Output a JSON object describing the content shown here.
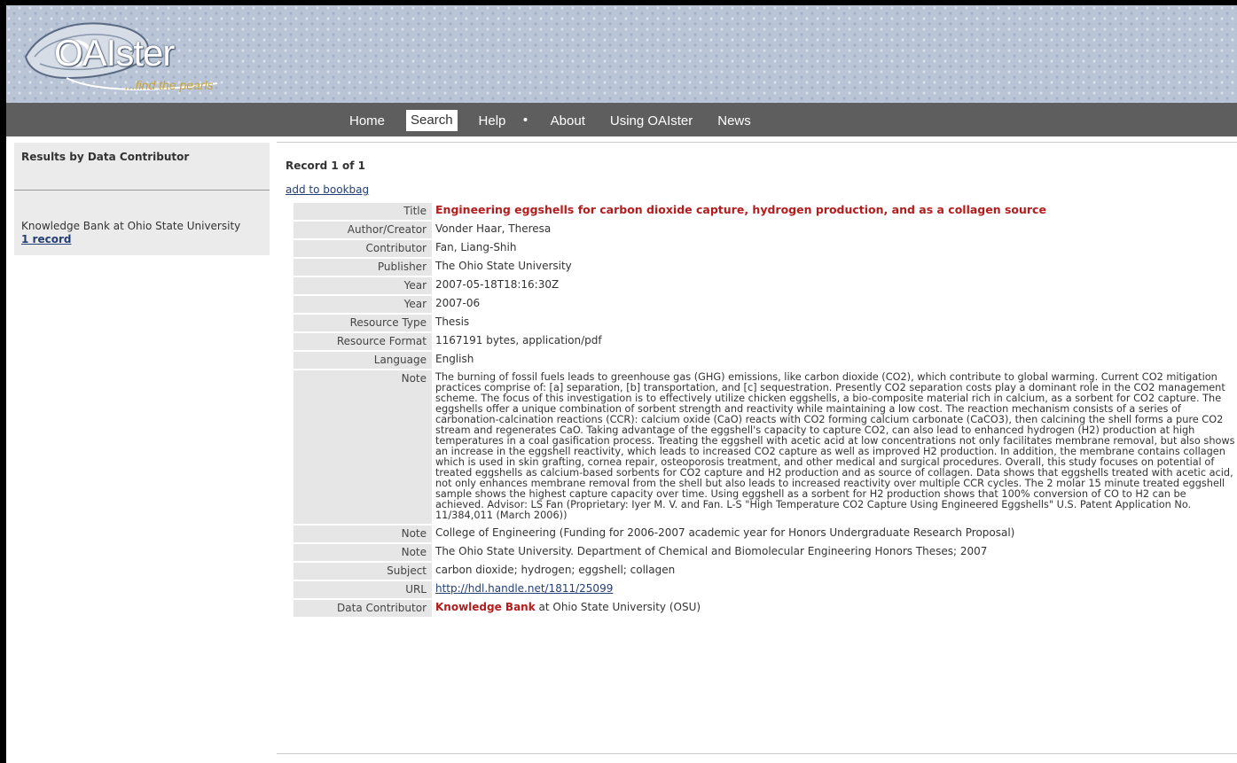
{
  "header": {
    "logo_name": "OAIster",
    "tagline": "...find the pearls",
    "pattern_colors": [
      "#b9c5d6",
      "#8c9cb4"
    ]
  },
  "nav": {
    "items": [
      {
        "label": "Home",
        "active": false
      },
      {
        "label": "Search",
        "active": true
      },
      {
        "label": "Help",
        "active": false
      },
      {
        "label": "About",
        "active": false
      },
      {
        "label": "Using OAIster",
        "active": false
      },
      {
        "label": "News",
        "active": false
      }
    ],
    "separator": "•"
  },
  "sidebar": {
    "title": "Results by Data Contributor",
    "contributor": "Knowledge Bank at Ohio State University",
    "count_link": "1 record"
  },
  "record": {
    "heading": "Record 1 of 1",
    "add_bookbag": "add to bookbag",
    "fields": [
      {
        "label": "Title",
        "value": "Engineering eggshells for carbon dioxide capture, hydrogen production, and as a collagen source"
      },
      {
        "label": "Author/Creator",
        "value": "Vonder Haar, Theresa"
      },
      {
        "label": "Contributor",
        "value": "Fan, Liang-Shih"
      },
      {
        "label": "Publisher",
        "value": "The Ohio State University"
      },
      {
        "label": "Year",
        "value": "2007-05-18T18:16:30Z"
      },
      {
        "label": "Year",
        "value": "2007-06"
      },
      {
        "label": "Resource Type",
        "value": "Thesis"
      },
      {
        "label": "Resource Format",
        "value": "1167191 bytes, application/pdf"
      },
      {
        "label": "Language",
        "value": "English"
      },
      {
        "label": "Note",
        "value": "The burning of fossil fuels leads to greenhouse gas (GHG) emissions, like carbon dioxide (CO2), which contribute to global warming. Current CO2 mitigation practices comprise of: [a] separation, [b] transportation, and [c] sequestration. Presently CO2 separation costs play a dominant role in the CO2 management scheme. The focus of this investigation is to effectively utilize chicken eggshells, a bio-composite material rich in calcium, as a sorbent for CO2 capture. The eggshells offer a unique combination of sorbent strength and reactivity while maintaining a low cost. The reaction mechanism consists of a series of carbonation-calcination reactions (CCR): calcium oxide (CaO) reacts with CO2 forming calcium carbonate (CaCO3), then calcining the shell forms a pure CO2 stream and regenerates CaO. Taking advantage of the eggshell's capacity to capture CO2, can also lead to enhanced hydrogen (H2) production at high temperatures in a coal gasification process. Treating the eggshell with acetic acid at low concentrations not only facilitates membrane removal, but also shows an increase in the eggshell reactivity, which leads to increased CO2 capture as well as improved H2 production. In addition, the membrane contains collagen which is used in skin grafting, cornea repair, osteoporosis treatment, and other medical and surgical procedures. Overall, this study focuses on potential of treated eggshells as calcium-based sorbents for CO2 capture and H2 production and as source of collagen. Data shows that eggshells treated with acetic acid, not only enhances membrane removal from the shell but also leads to increased reactivity over multiple CCR cycles. The 2 molar 15 minute treated eggshell sample shows the highest capture capacity over time. Using eggshell as a sorbent for H2 production shows that 100% conversion of CO to H2 can be achieved. Advisor: LS Fan (Proprietary: Iyer M. V. and Fan. L-S \"High Temperature CO2 Capture Using Engineered Eggshells\" U.S. Patent Application No. 11/384,011 (March 2006))"
      },
      {
        "label": "Note",
        "value": "College of Engineering (Funding for 2006-2007 academic year for Honors Undergraduate Research Proposal)"
      },
      {
        "label": "Note",
        "value": "The Ohio State University. Department of Chemical and Biomolecular Engineering Honors Theses; 2007"
      },
      {
        "label": "Subject",
        "value": "carbon dioxide; hydrogen; eggshell; collagen"
      },
      {
        "label": "URL",
        "value": "http://hdl.handle.net/1811/25099"
      },
      {
        "label": "Data Contributor",
        "value_strong": "Knowledge Bank",
        "value_rest": " at Ohio State University (OSU)"
      }
    ]
  },
  "colors": {
    "navbar": "#5e5e5e",
    "sidebar": "#ebebeb",
    "label_cell": "#e6e6e6",
    "title_red": "#b21d1d",
    "link_blue": "#233f75"
  }
}
